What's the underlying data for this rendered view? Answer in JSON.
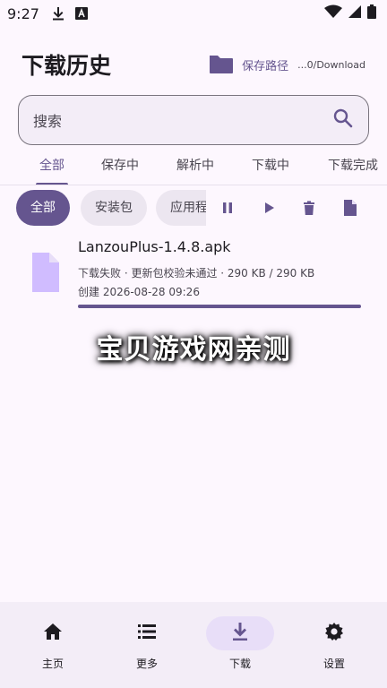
{
  "status_bar": {
    "time": "9:27",
    "left_icons": [
      "download-icon",
      "font-a-icon"
    ],
    "right_icons": [
      "wifi-icon",
      "signal-icon",
      "battery-icon"
    ]
  },
  "header": {
    "title": "下载历史",
    "save_path_label": "保存路径",
    "save_path_value": "...0/Download"
  },
  "search": {
    "placeholder": "搜索"
  },
  "tabs": [
    {
      "label": "全部",
      "active": true
    },
    {
      "label": "保存中"
    },
    {
      "label": "解析中"
    },
    {
      "label": "下载中"
    },
    {
      "label": "下载完成"
    }
  ],
  "filters": [
    {
      "label": "全部",
      "active": true
    },
    {
      "label": "安装包"
    },
    {
      "label": "应用程序"
    }
  ],
  "actions": [
    "pause-icon",
    "play-icon",
    "delete-icon",
    "file-icon"
  ],
  "downloads": [
    {
      "name": "LanzouPlus-1.4.8.apk",
      "status": "下载失败 · 更新包校验未通过 · 290 KB / 290 KB",
      "created": "创建 2026-08-28 09:26",
      "progress": 1.0
    }
  ],
  "watermark": "宝贝游戏网亲测",
  "bottom_nav": [
    {
      "label": "主页",
      "icon": "home-icon"
    },
    {
      "label": "更多",
      "icon": "list-icon"
    },
    {
      "label": "下载",
      "icon": "download-icon",
      "active": true
    },
    {
      "label": "设置",
      "icon": "settings-icon"
    }
  ],
  "colors": {
    "primary": "#65558f",
    "surface": "#fdf7fe",
    "surface_container": "#f3edf7",
    "secondary_container": "#e8def8",
    "file_icon": "#d0bcff"
  }
}
